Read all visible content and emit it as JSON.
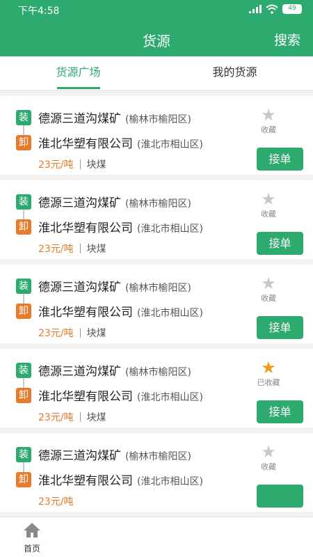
{
  "status_bar": {
    "time": "下午4:58",
    "battery": "49"
  },
  "header": {
    "title": "货源",
    "search": "搜索"
  },
  "tabs": [
    {
      "label": "货源广场"
    },
    {
      "label": "我的货源"
    }
  ],
  "cards": [
    {
      "from": "德源三道沟煤矿",
      "from_loc": "(榆林市榆阳区)",
      "to": "淮北华塑有限公司",
      "to_loc": "(淮北市相山区)",
      "price": "23元/吨",
      "goods": "块煤",
      "fav_label": "收藏",
      "accept": "接单",
      "favorited": false
    },
    {
      "from": "德源三道沟煤矿",
      "from_loc": "(榆林市榆阳区)",
      "to": "淮北华塑有限公司",
      "to_loc": "(淮北市相山区)",
      "price": "23元/吨",
      "goods": "块煤",
      "fav_label": "收藏",
      "accept": "接单",
      "favorited": false
    },
    {
      "from": "德源三道沟煤矿",
      "from_loc": "(榆林市榆阳区)",
      "to": "淮北华塑有限公司",
      "to_loc": "(淮北市相山区)",
      "price": "23元/吨",
      "goods": "块煤",
      "fav_label": "收藏",
      "accept": "接单",
      "favorited": false
    },
    {
      "from": "德源三道沟煤矿",
      "from_loc": "(榆林市榆阳区)",
      "to": "淮北华塑有限公司",
      "to_loc": "(淮北市相山区)",
      "price": "23元/吨",
      "goods": "块煤",
      "fav_label": "已收藏",
      "accept": "接单",
      "favorited": true
    },
    {
      "from": "德源三道沟煤矿",
      "from_loc": "(榆林市榆阳区)",
      "to": "淮北华塑有限公司",
      "to_loc": "(淮北市相山区)",
      "price": "23元/吨",
      "goods": "",
      "fav_label": "收藏",
      "accept": "",
      "favorited": false
    }
  ],
  "tags": {
    "load": "装",
    "unload": "卸"
  },
  "bottom_nav": {
    "home": "首页",
    "home_icon": "home-icon"
  },
  "colors": {
    "primary": "#2daa6e",
    "accent": "#e87b2b",
    "star_on": "#f19b1d"
  }
}
